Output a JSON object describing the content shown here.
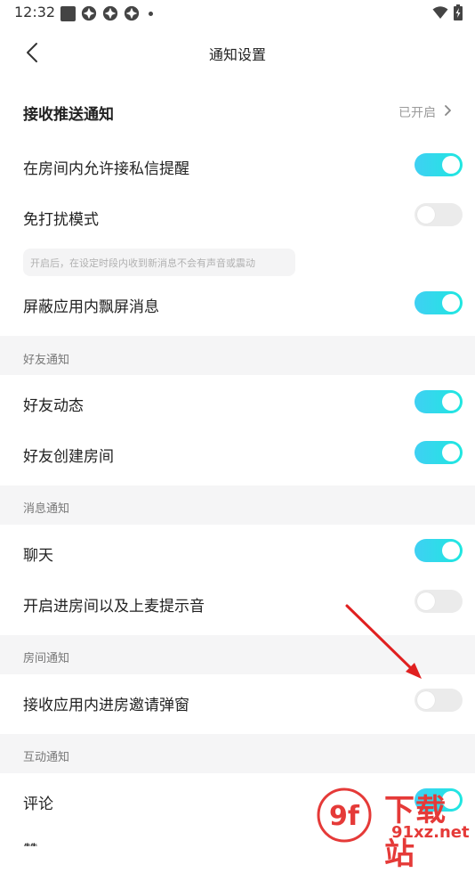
{
  "status_bar": {
    "time": "12:32"
  },
  "header": {
    "title": "通知设置"
  },
  "push": {
    "label": "接收推送通知",
    "status": "已开启"
  },
  "items": {
    "private_msg": {
      "label": "在房间内允许接私信提醒",
      "on": true
    },
    "dnd": {
      "label": "免打扰模式",
      "on": false,
      "hint": "开启后，在设定时段内收到新消息不会有声音或震动"
    },
    "block_float": {
      "label": "屏蔽应用内飘屏消息",
      "on": true
    },
    "friend_dynamic": {
      "label": "好友动态",
      "on": true
    },
    "friend_room": {
      "label": "好友创建房间",
      "on": true
    },
    "chat": {
      "label": "聊天",
      "on": true
    },
    "room_sound": {
      "label": "开启进房间以及上麦提示音",
      "on": false
    },
    "room_invite": {
      "label": "接收应用内进房邀请弹窗",
      "on": false
    },
    "comment": {
      "label": "评论",
      "on": true
    },
    "like": {
      "label": "赞"
    }
  },
  "sections": {
    "friend": "好友通知",
    "message": "消息通知",
    "room": "房间通知",
    "interaction": "互动通知"
  },
  "watermark": {
    "logo_text": "9f",
    "cn": "下载站",
    "url": "91xz.net"
  },
  "colors": {
    "toggle_on_start": "#3fd0f3",
    "toggle_on_end": "#1fe7e0",
    "toggle_off": "#ebebeb",
    "section_bg": "#f5f5f6",
    "annotation_arrow": "#e02020",
    "watermark": "#e53a38"
  }
}
